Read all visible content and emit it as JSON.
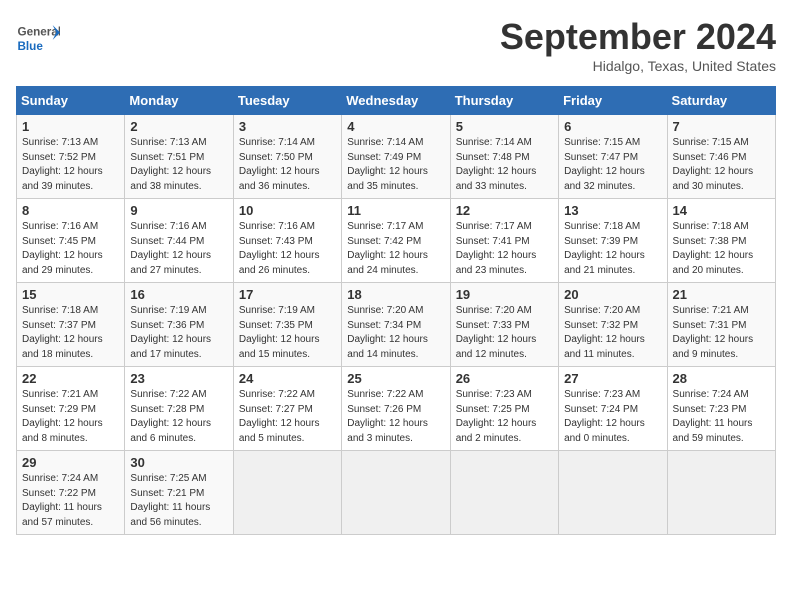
{
  "header": {
    "logo_line1": "General",
    "logo_line2": "Blue",
    "title": "September 2024",
    "subtitle": "Hidalgo, Texas, United States"
  },
  "weekdays": [
    "Sunday",
    "Monday",
    "Tuesday",
    "Wednesday",
    "Thursday",
    "Friday",
    "Saturday"
  ],
  "weeks": [
    [
      {
        "day": "1",
        "sunrise": "7:13 AM",
        "sunset": "7:52 PM",
        "daylight": "12 hours and 39 minutes."
      },
      {
        "day": "2",
        "sunrise": "7:13 AM",
        "sunset": "7:51 PM",
        "daylight": "12 hours and 38 minutes."
      },
      {
        "day": "3",
        "sunrise": "7:14 AM",
        "sunset": "7:50 PM",
        "daylight": "12 hours and 36 minutes."
      },
      {
        "day": "4",
        "sunrise": "7:14 AM",
        "sunset": "7:49 PM",
        "daylight": "12 hours and 35 minutes."
      },
      {
        "day": "5",
        "sunrise": "7:14 AM",
        "sunset": "7:48 PM",
        "daylight": "12 hours and 33 minutes."
      },
      {
        "day": "6",
        "sunrise": "7:15 AM",
        "sunset": "7:47 PM",
        "daylight": "12 hours and 32 minutes."
      },
      {
        "day": "7",
        "sunrise": "7:15 AM",
        "sunset": "7:46 PM",
        "daylight": "12 hours and 30 minutes."
      }
    ],
    [
      {
        "day": "8",
        "sunrise": "7:16 AM",
        "sunset": "7:45 PM",
        "daylight": "12 hours and 29 minutes."
      },
      {
        "day": "9",
        "sunrise": "7:16 AM",
        "sunset": "7:44 PM",
        "daylight": "12 hours and 27 minutes."
      },
      {
        "day": "10",
        "sunrise": "7:16 AM",
        "sunset": "7:43 PM",
        "daylight": "12 hours and 26 minutes."
      },
      {
        "day": "11",
        "sunrise": "7:17 AM",
        "sunset": "7:42 PM",
        "daylight": "12 hours and 24 minutes."
      },
      {
        "day": "12",
        "sunrise": "7:17 AM",
        "sunset": "7:41 PM",
        "daylight": "12 hours and 23 minutes."
      },
      {
        "day": "13",
        "sunrise": "7:18 AM",
        "sunset": "7:39 PM",
        "daylight": "12 hours and 21 minutes."
      },
      {
        "day": "14",
        "sunrise": "7:18 AM",
        "sunset": "7:38 PM",
        "daylight": "12 hours and 20 minutes."
      }
    ],
    [
      {
        "day": "15",
        "sunrise": "7:18 AM",
        "sunset": "7:37 PM",
        "daylight": "12 hours and 18 minutes."
      },
      {
        "day": "16",
        "sunrise": "7:19 AM",
        "sunset": "7:36 PM",
        "daylight": "12 hours and 17 minutes."
      },
      {
        "day": "17",
        "sunrise": "7:19 AM",
        "sunset": "7:35 PM",
        "daylight": "12 hours and 15 minutes."
      },
      {
        "day": "18",
        "sunrise": "7:20 AM",
        "sunset": "7:34 PM",
        "daylight": "12 hours and 14 minutes."
      },
      {
        "day": "19",
        "sunrise": "7:20 AM",
        "sunset": "7:33 PM",
        "daylight": "12 hours and 12 minutes."
      },
      {
        "day": "20",
        "sunrise": "7:20 AM",
        "sunset": "7:32 PM",
        "daylight": "12 hours and 11 minutes."
      },
      {
        "day": "21",
        "sunrise": "7:21 AM",
        "sunset": "7:31 PM",
        "daylight": "12 hours and 9 minutes."
      }
    ],
    [
      {
        "day": "22",
        "sunrise": "7:21 AM",
        "sunset": "7:29 PM",
        "daylight": "12 hours and 8 minutes."
      },
      {
        "day": "23",
        "sunrise": "7:22 AM",
        "sunset": "7:28 PM",
        "daylight": "12 hours and 6 minutes."
      },
      {
        "day": "24",
        "sunrise": "7:22 AM",
        "sunset": "7:27 PM",
        "daylight": "12 hours and 5 minutes."
      },
      {
        "day": "25",
        "sunrise": "7:22 AM",
        "sunset": "7:26 PM",
        "daylight": "12 hours and 3 minutes."
      },
      {
        "day": "26",
        "sunrise": "7:23 AM",
        "sunset": "7:25 PM",
        "daylight": "12 hours and 2 minutes."
      },
      {
        "day": "27",
        "sunrise": "7:23 AM",
        "sunset": "7:24 PM",
        "daylight": "12 hours and 0 minutes."
      },
      {
        "day": "28",
        "sunrise": "7:24 AM",
        "sunset": "7:23 PM",
        "daylight": "11 hours and 59 minutes."
      }
    ],
    [
      {
        "day": "29",
        "sunrise": "7:24 AM",
        "sunset": "7:22 PM",
        "daylight": "11 hours and 57 minutes."
      },
      {
        "day": "30",
        "sunrise": "7:25 AM",
        "sunset": "7:21 PM",
        "daylight": "11 hours and 56 minutes."
      },
      null,
      null,
      null,
      null,
      null
    ]
  ],
  "labels": {
    "sunrise": "Sunrise:",
    "sunset": "Sunset:",
    "daylight": "Daylight:"
  },
  "colors": {
    "header_bg": "#2e6db4",
    "logo_blue": "#1a6bbf"
  }
}
